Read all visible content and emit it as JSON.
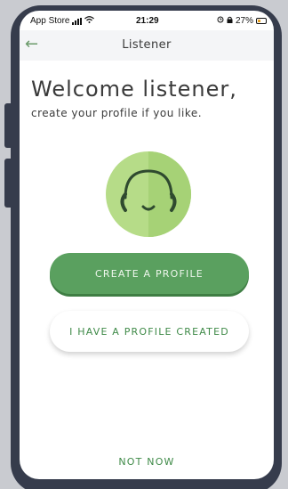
{
  "status_bar": {
    "carrier": "App Store",
    "time": "21:29",
    "battery_percent": "27%",
    "icons": [
      "signal-icon",
      "wifi-icon",
      "alarm-icon",
      "lock-icon",
      "battery-icon"
    ]
  },
  "nav": {
    "back_icon": "back-arrow-icon",
    "title": "Listener"
  },
  "welcome": {
    "title": "Welcome listener,",
    "subtitle": "create your profile if you like."
  },
  "avatar": {
    "icon": "headphones-smiley-icon"
  },
  "actions": {
    "create_profile": "CREATE A PROFILE",
    "have_profile": "I HAVE A PROFILE CREATED",
    "not_now": "NOT NOW"
  },
  "colors": {
    "primary_green": "#5aa05f",
    "text_green": "#3f8a48",
    "avatar_green": "#b6dc88",
    "frame": "#363c4c"
  }
}
